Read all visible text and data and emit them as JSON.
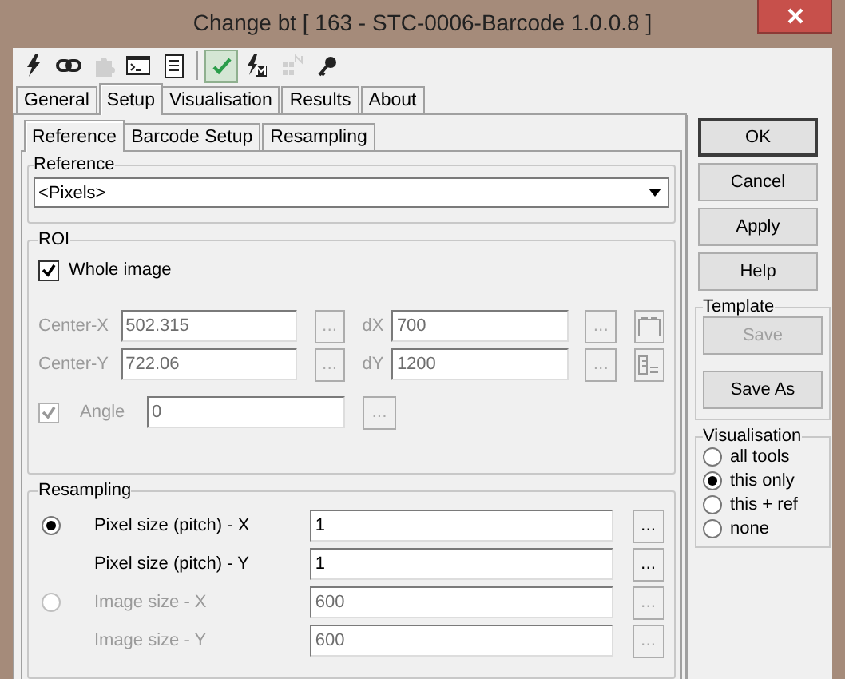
{
  "window": {
    "title": "Change bt [ 163 - STC-0006-Barcode 1.0.0.8 ]"
  },
  "toolbar": [
    {
      "kind": "bolt",
      "pressed": false,
      "disabled": false
    },
    {
      "kind": "link",
      "pressed": false,
      "disabled": false
    },
    {
      "kind": "puzzle",
      "pressed": false,
      "disabled": true
    },
    {
      "kind": "console",
      "pressed": false,
      "disabled": false
    },
    {
      "kind": "sheet",
      "pressed": false,
      "disabled": false
    },
    {
      "kind": "check",
      "pressed": true,
      "disabled": false
    },
    {
      "kind": "bolt-m",
      "pressed": false,
      "disabled": false
    },
    {
      "kind": "grid",
      "pressed": false,
      "disabled": true
    },
    {
      "kind": "key",
      "pressed": false,
      "disabled": false
    }
  ],
  "tabs": [
    {
      "label": "General",
      "selected": false
    },
    {
      "label": "Setup",
      "selected": true
    },
    {
      "label": "Visualisation",
      "selected": false
    },
    {
      "label": "Results",
      "selected": false
    },
    {
      "label": "About",
      "selected": false
    }
  ],
  "subtabs": [
    {
      "label": "Reference",
      "selected": true
    },
    {
      "label": "Barcode Setup",
      "selected": false
    },
    {
      "label": "Resampling",
      "selected": false
    }
  ],
  "reference": {
    "title": "Reference",
    "value": "<Pixels>"
  },
  "roi": {
    "title": "ROI",
    "whole_image": {
      "label": "Whole image",
      "checked": true
    },
    "fields": [
      {
        "label": "Center-X",
        "value": "502.315",
        "disabled": true
      },
      {
        "label": "dX",
        "value": "700",
        "disabled": true
      },
      {
        "label": "Center-Y",
        "value": "722.06",
        "disabled": true
      },
      {
        "label": "dY",
        "value": "1200",
        "disabled": true
      }
    ],
    "angle": {
      "label": "Angle",
      "checked": true,
      "disabled": true,
      "value": "0"
    },
    "dots": "..."
  },
  "resampling": {
    "title": "Resampling",
    "options": [
      {
        "selected": true,
        "rows": [
          {
            "label": "Pixel size (pitch) - X",
            "value": "1",
            "disabled": false,
            "dots": "..."
          },
          {
            "label": "Pixel size (pitch) - Y",
            "value": "1",
            "disabled": false,
            "dots": "..."
          }
        ]
      },
      {
        "selected": false,
        "rows": [
          {
            "label": "Image size - X",
            "value": "600",
            "disabled": true,
            "dots": "..."
          },
          {
            "label": "Image size - Y",
            "value": "600",
            "disabled": true,
            "dots": "..."
          }
        ]
      }
    ]
  },
  "buttons": [
    {
      "label": "OK",
      "default": true
    },
    {
      "label": "Cancel",
      "default": false
    },
    {
      "label": "Apply",
      "default": false
    },
    {
      "label": "Help",
      "default": false
    }
  ],
  "template": {
    "title": "Template",
    "buttons": [
      {
        "label": "Save",
        "disabled": true
      },
      {
        "label": "Save As",
        "disabled": false
      }
    ]
  },
  "visualisation": {
    "title": "Visualisation",
    "options": [
      {
        "label": "all tools",
        "selected": false
      },
      {
        "label": "this only",
        "selected": true
      },
      {
        "label": "this + ref",
        "selected": false
      },
      {
        "label": "none",
        "selected": false
      }
    ]
  }
}
